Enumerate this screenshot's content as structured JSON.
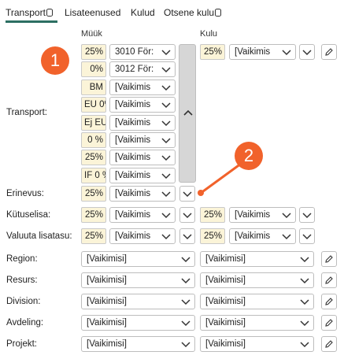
{
  "tabs": [
    {
      "label": "Transport"
    },
    {
      "label": "Lisateenused"
    },
    {
      "label": "Kulud"
    },
    {
      "label": "Otsene kulu"
    }
  ],
  "columns": {
    "sales": "Müük",
    "cost": "Kulu"
  },
  "labels": {
    "transport": "Transport:",
    "erinevus": "Erinevus:",
    "kytuselisa": "Kütuselisa:",
    "valuuta": "Valuuta lisatasu:",
    "region": "Region:",
    "resurs": "Resurs:",
    "division": "Division:",
    "avdeling": "Avdeling:",
    "projekt": "Projekt:"
  },
  "transport_rows": [
    {
      "rate": "25%",
      "vat": "3010 För:"
    },
    {
      "rate": "0%",
      "vat": "3012 För:"
    },
    {
      "rate": "BM",
      "vat": "[Vaikimis"
    },
    {
      "rate": "EU 0%",
      "vat": "[Vaikimis"
    },
    {
      "rate": "Ej EU",
      "vat": "[Vaikimis"
    },
    {
      "rate": "0 %",
      "vat": "[Vaikimis"
    },
    {
      "rate": "25%",
      "vat": "[Vaikimis"
    },
    {
      "rate": "IF 0 %",
      "vat": "[Vaikimis"
    }
  ],
  "transport_cost": {
    "rate": "25%",
    "vat": "[Vaikimis"
  },
  "erinevus": {
    "rate": "25%",
    "vat": "[Vaikimis"
  },
  "kytuselisa": {
    "sales_rate": "25%",
    "sales_vat": "[Vaikimis",
    "cost_rate": "25%",
    "cost_vat": "[Vaikimis"
  },
  "valuuta": {
    "sales_rate": "25%",
    "sales_vat": "[Vaikimis",
    "cost_rate": "25%",
    "cost_vat": "[Vaikimis"
  },
  "dimensions": {
    "region": {
      "sales": "[Vaikimisi]",
      "cost": "[Vaikimisi]"
    },
    "resurs": {
      "sales": "[Vaikimisi]",
      "cost": "[Vaikimisi]"
    },
    "division": {
      "sales": "[Vaikimisi]",
      "cost": "[Vaikimisi]"
    },
    "avdeling": {
      "sales": "[Vaikimisi]",
      "cost": "[Vaikimisi]"
    },
    "projekt": {
      "sales": "[Vaikimisi]",
      "cost": "[Vaikimisi]"
    }
  },
  "callouts": {
    "one": "1",
    "two": "2"
  },
  "colors": {
    "tab_underline": "#2c6f62",
    "rate_bg": "#fbf4d8",
    "callout": "#f1622b"
  },
  "icons": [
    "database-icon",
    "chevron-down-icon",
    "chevron-up-icon",
    "pencil-icon"
  ]
}
